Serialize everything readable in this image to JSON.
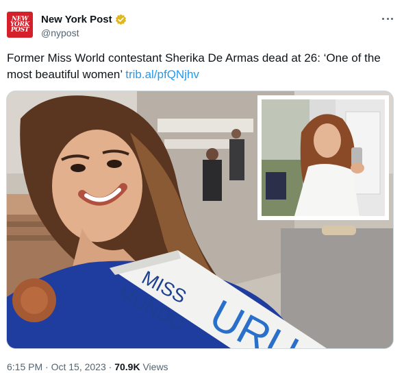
{
  "account": {
    "avatar_text": [
      "NEW",
      "YORK",
      "POST"
    ],
    "display_name": "New York Post",
    "handle": "@nypost",
    "verified": true
  },
  "tweet": {
    "text": "Former Miss World contestant Sherika De Armas dead at 26: ‘One of the most beautiful women’ ",
    "link": "trib.al/pfQNjhv"
  },
  "media": {
    "sash_line1": "MISS",
    "sash_line2": "MUNDO",
    "sash_country": "URU"
  },
  "meta": {
    "time": "6:15 PM",
    "separator": "·",
    "date": "Oct 15, 2023",
    "views_count": "70.9K",
    "views_label": "Views"
  },
  "colors": {
    "brand_red": "#d4202a",
    "link": "#1d9bf0",
    "secondary_text": "#536471",
    "verified_gold": "#e2b719"
  }
}
